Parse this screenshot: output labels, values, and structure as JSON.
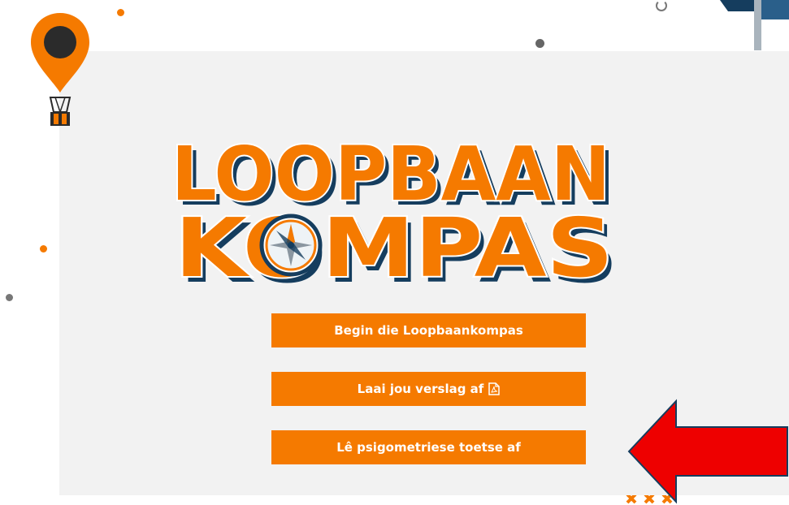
{
  "logo": {
    "line1": "LOOPBAAN",
    "line2": "KOMPAS"
  },
  "buttons": {
    "begin": "Begin die Loopbaankompas",
    "download_report": "Laai jou verslag af",
    "upload_tests": "Lê psigometriese toetse af"
  },
  "icons": {
    "balloon": "map-pin-balloon-icon",
    "compass": "compass-icon",
    "pdf": "pdf-file-icon",
    "arrow": "red-left-arrow-icon"
  },
  "colors": {
    "orange": "#f57a00",
    "navy": "#153d5e",
    "panel": "#f2f2f2",
    "arrow": "#ee0000"
  }
}
